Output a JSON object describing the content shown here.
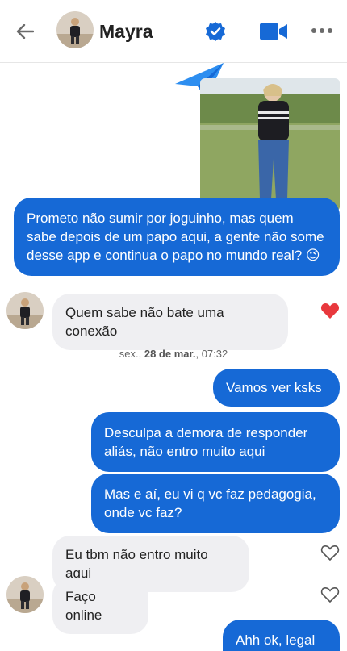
{
  "header": {
    "contact_name": "Mayra",
    "back_icon": "arrow-left-icon",
    "verified_icon": "verified-badge-icon",
    "video_icon": "video-camera-icon",
    "more_icon": "more-dots-icon"
  },
  "colors": {
    "accent": "#1669d6",
    "incoming_bubble": "#efeff2",
    "heart_liked": "#e8383d"
  },
  "messages": {
    "m1": "Prometo não sumir por joguinho, mas quem sabe depois de um papo aqui, a gente não some desse app e continua o papo no mundo real? 😉",
    "m2": "Quem sabe não bate uma conexão",
    "m3": "Vamos ver ksks",
    "m4": "Desculpa a demora de responder aliás, não entro muito aqui",
    "m5": "Mas e aí, eu vi q vc faz pedagogia, onde vc faz?",
    "m6": "Eu tbm não entro muito aqui",
    "m7": "Faço online",
    "m8": "Ahh ok, legal"
  },
  "timestamp": {
    "day": "sex.,",
    "date": "28 de mar.",
    "time": ", 07:32"
  }
}
